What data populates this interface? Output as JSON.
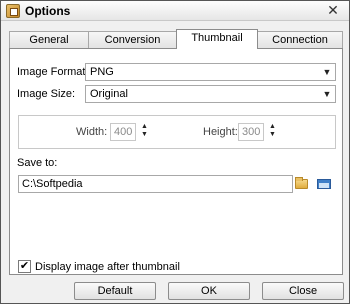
{
  "window": {
    "title": "Options"
  },
  "tabs": [
    {
      "label": "General"
    },
    {
      "label": "Conversion"
    },
    {
      "label": "Thumbnail"
    },
    {
      "label": "Connection"
    }
  ],
  "thumbnail": {
    "image_format_label": "Image Format:",
    "image_format_value": "PNG",
    "image_size_label": "Image Size:",
    "image_size_value": "Original",
    "width_label": "Width:",
    "width_value": "400",
    "height_label": "Height:",
    "height_value": "300",
    "save_to_label": "Save to:",
    "save_to_value": "C:\\Softpedia",
    "display_after_label": "Display image after thumbnail",
    "display_after_checked": true
  },
  "buttons": {
    "default": "Default",
    "ok": "OK",
    "close": "Close"
  },
  "icons": {
    "app": "options-app-icon",
    "close": "close-icon",
    "dropdown": "chevron-down-icon",
    "spin_up": "arrow-up-icon",
    "spin_down": "arrow-down-icon",
    "browse": "folder-icon",
    "open": "window-icon",
    "check": "checkmark-icon"
  }
}
